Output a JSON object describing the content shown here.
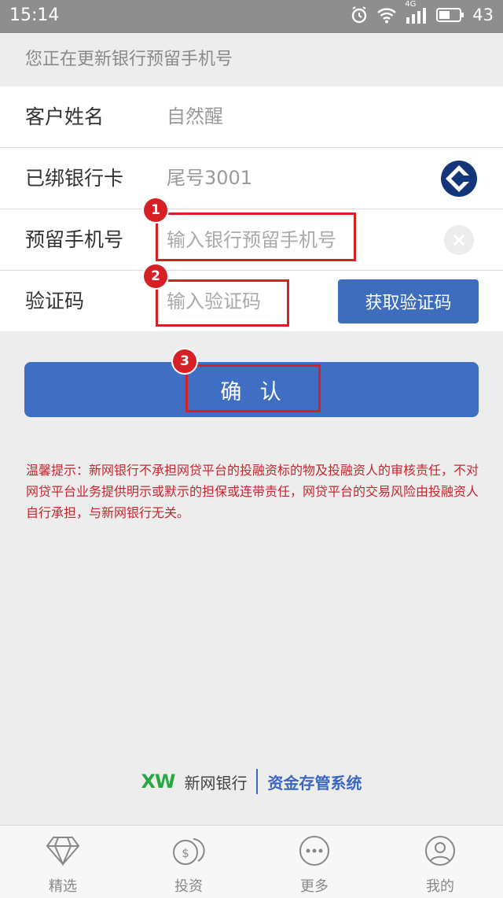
{
  "status_bar": {
    "time": "15:14",
    "network": "4G",
    "battery": "43",
    "icons": [
      "alarm-icon",
      "wifi-icon",
      "signal-icon",
      "battery-icon"
    ]
  },
  "notice": "您正在更新银行预留手机号",
  "form": {
    "customer_name": {
      "label": "客户姓名",
      "value": "自然醒"
    },
    "bound_card": {
      "label": "已绑银行卡",
      "value": "尾号3001",
      "icon": "bank-logo-icon"
    },
    "phone": {
      "label": "预留手机号",
      "value": "",
      "placeholder": "输入银行预留手机号",
      "clear_icon": "clear-icon"
    },
    "code": {
      "label": "验证码",
      "value": "",
      "placeholder": "输入验证码",
      "button": "获取验证码"
    }
  },
  "annotations": [
    "1",
    "2",
    "3"
  ],
  "confirm_button": "确  认",
  "disclaimer": "温馨提示：新网银行不承担网贷平台的投融资标的物及投融资人的审核责任，不对网贷平台业务提供明示或默示的担保或连带责任，网贷平台的交易风险由投融资人自行承担，与新网银行无关。",
  "brand": {
    "logo_text": "XW",
    "name": "新网银行",
    "system": "资金存管系统"
  },
  "tabbar": [
    {
      "label": "精选",
      "icon": "diamond-icon"
    },
    {
      "label": "投资",
      "icon": "coins-icon"
    },
    {
      "label": "更多",
      "icon": "more-icon"
    },
    {
      "label": "我的",
      "icon": "user-icon"
    }
  ],
  "colors": {
    "accent": "#3f6ec2",
    "annotation": "#d71f26",
    "warning_text": "#c7262e"
  }
}
